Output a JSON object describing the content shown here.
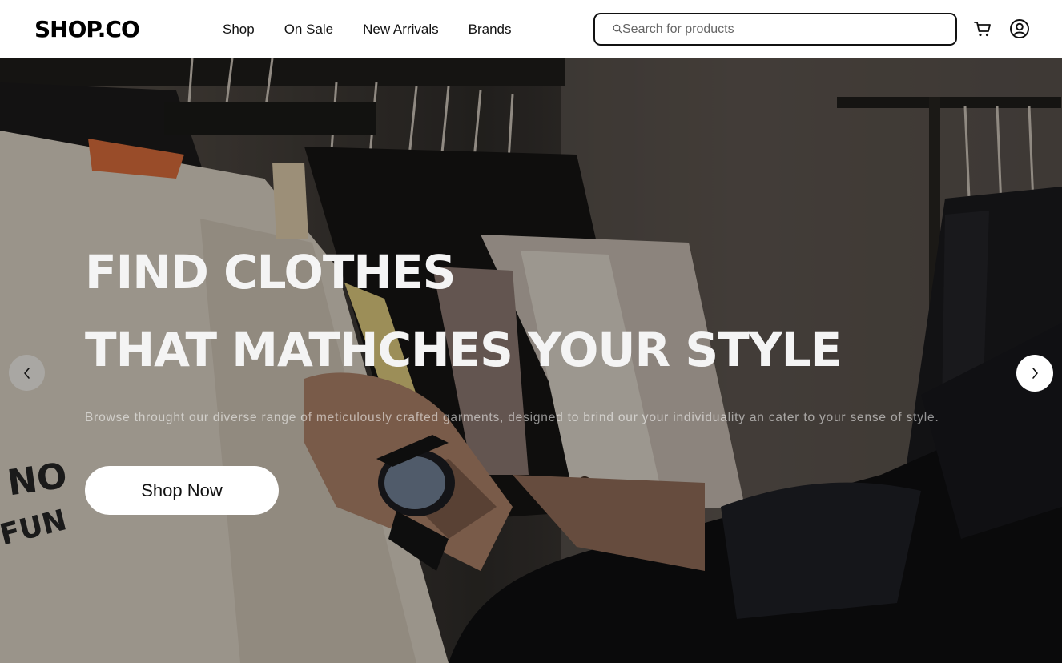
{
  "header": {
    "logo": "SHOP.CO",
    "nav": [
      "Shop",
      "On Sale",
      "New Arrivals",
      "Brands"
    ],
    "search": {
      "placeholder": "Search for products"
    },
    "icons": {
      "search": "search-icon",
      "cart": "cart-icon",
      "account": "account-icon"
    }
  },
  "hero": {
    "headline_line1": "FIND CLOTHES",
    "headline_line2": "THAT MATHCHES YOUR STYLE",
    "subtext": "Browse throught our diverse range of meticulously crafted garments, designed to brind our your individuality an cater to your sense of style.",
    "cta_label": "Shop Now",
    "tshirt_print": "NO FUN",
    "icons": {
      "prev": "chevron-left-icon",
      "next": "chevron-right-icon"
    }
  },
  "colors": {
    "text_primary": "#000000",
    "hero_overlay": "rgba(0,0,0,0.28)",
    "button_bg": "#ffffff"
  }
}
